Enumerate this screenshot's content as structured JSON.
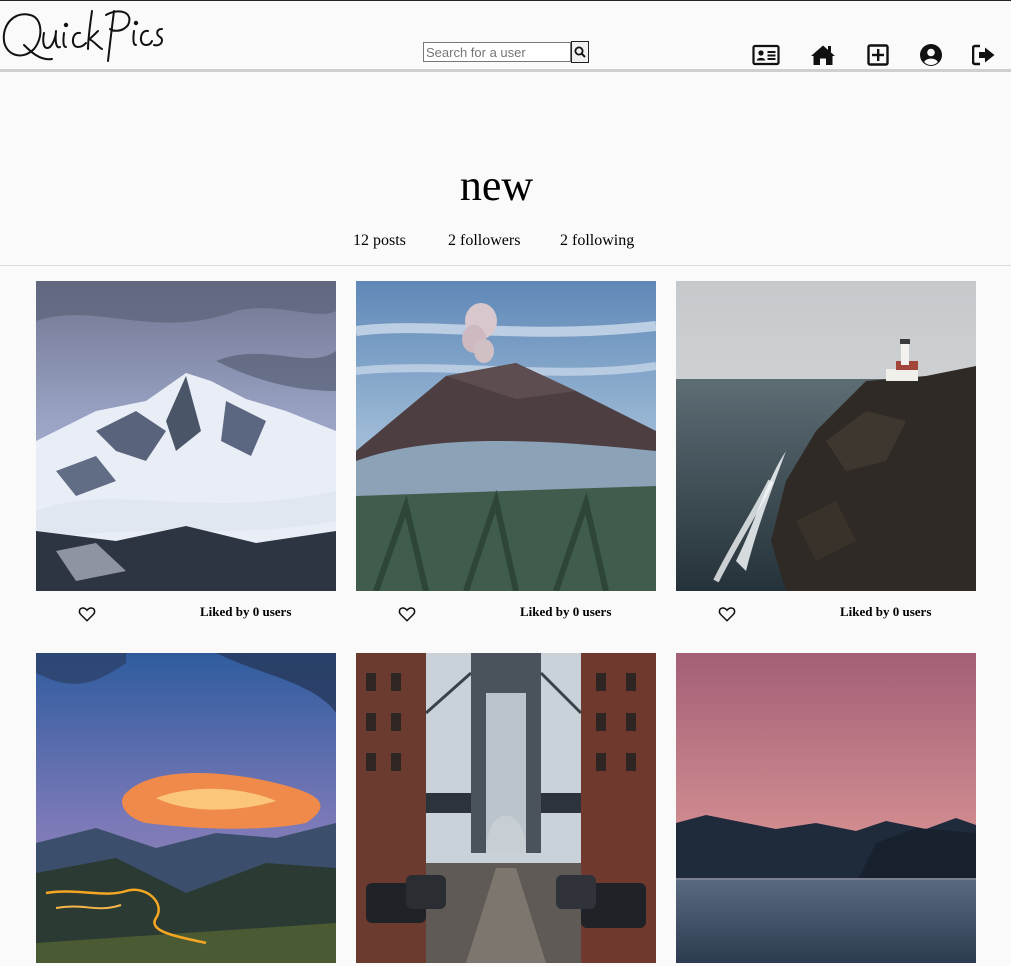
{
  "app": {
    "logo_text": "QuickPics"
  },
  "search": {
    "placeholder": "Search for a user"
  },
  "nav": {
    "icons": [
      "id-card-icon",
      "home-icon",
      "plus-square-icon",
      "user-circle-icon",
      "sign-out-icon"
    ]
  },
  "profile": {
    "username": "new",
    "posts": "12 posts",
    "followers": "2 followers",
    "following": "2 following"
  },
  "posts": [
    {
      "scene": "snowy-mountain",
      "likes": "Liked by 0 users"
    },
    {
      "scene": "volcano",
      "likes": "Liked by 0 users"
    },
    {
      "scene": "lighthouse-cliff",
      "likes": "Liked by 0 users"
    },
    {
      "scene": "sunset-valley",
      "likes": ""
    },
    {
      "scene": "city-bridge",
      "likes": ""
    },
    {
      "scene": "dusk-lake",
      "likes": ""
    }
  ]
}
